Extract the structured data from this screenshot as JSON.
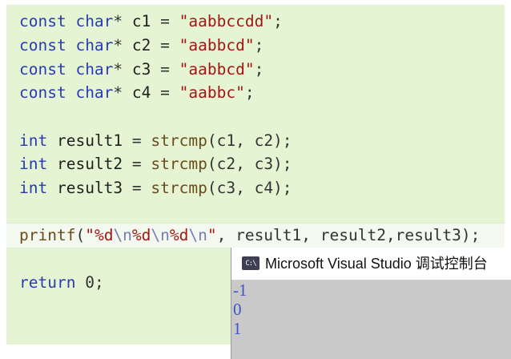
{
  "editor": {
    "lines": [
      {
        "kw": "const",
        "type": "char",
        "ptr": "*",
        "name": "c1",
        "eq": "=",
        "str": "\"aabbccdd\"",
        "semi": ";"
      },
      {
        "kw": "const",
        "type": "char",
        "ptr": "*",
        "name": "c2",
        "eq": "=",
        "str": "\"aabbcd\"",
        "semi": ";"
      },
      {
        "kw": "const",
        "type": "char",
        "ptr": "*",
        "name": "c3",
        "eq": "=",
        "str": "\"aabbcd\"",
        "semi": ";"
      },
      {
        "kw": "const",
        "type": "char",
        "ptr": "*",
        "name": "c4",
        "eq": "=",
        "str": "\"aabbc\"",
        "semi": ";"
      }
    ],
    "calls": [
      {
        "type": "int",
        "name": "result1",
        "eq": "=",
        "fn": "strcmp",
        "args": "(c1, c2);"
      },
      {
        "type": "int",
        "name": "result2",
        "eq": "=",
        "fn": "strcmp",
        "args": "(c2, c3);"
      },
      {
        "type": "int",
        "name": "result3",
        "eq": "=",
        "fn": "strcmp",
        "args": "(c3, c4);"
      }
    ],
    "printf": {
      "fn": "printf",
      "open": "(",
      "q1": "\"",
      "f1": "%d",
      "e1": "\\n",
      "f2": "%d",
      "e2": "\\n",
      "f3": "%d",
      "e3": "\\n",
      "q2": "\"",
      "rest": ", result1, result2,result3);"
    },
    "return_kw": "return",
    "return_val": "0;"
  },
  "console": {
    "icon": "C:\\",
    "title": "Microsoft Visual Studio 调试控制台",
    "output": [
      "-1",
      "0",
      "1"
    ]
  },
  "colors": {
    "editor_bg": "#e5f5d3",
    "keyword": "#2a3ab0",
    "string": "#a31515",
    "function": "#6a4c1a",
    "console_output": "#3b56c8"
  }
}
